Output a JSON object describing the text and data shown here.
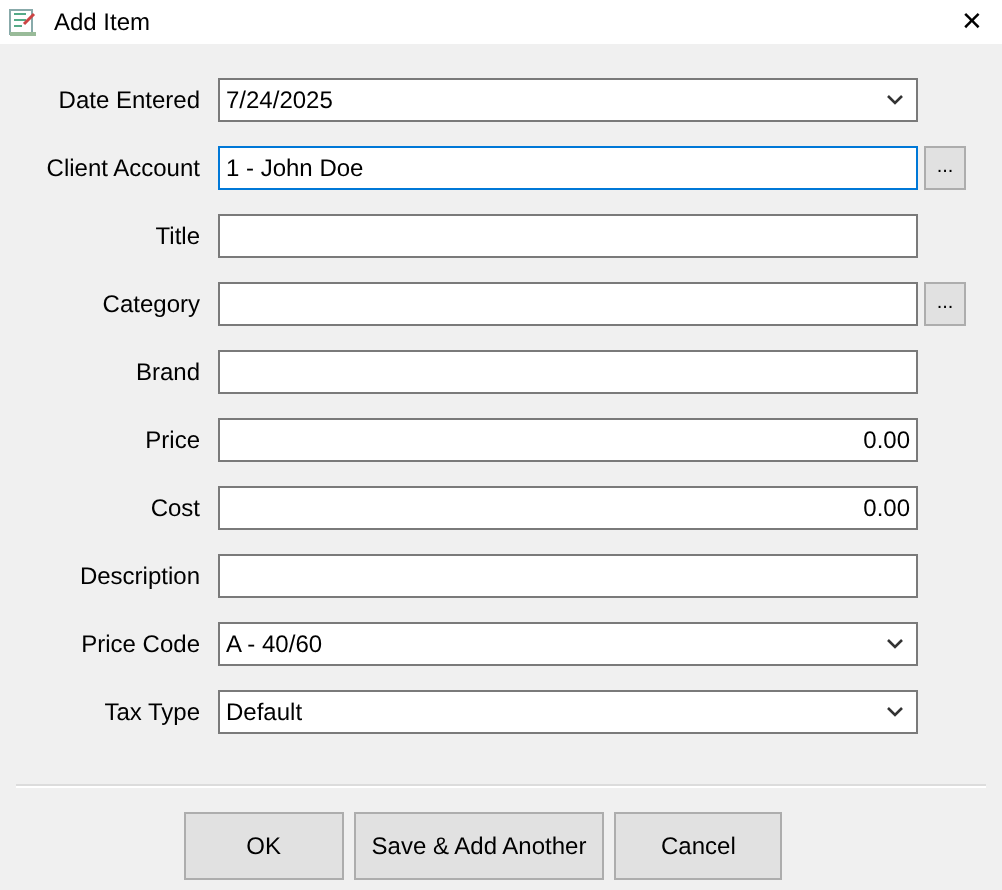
{
  "window": {
    "title": "Add Item",
    "close": "✕"
  },
  "fields": [
    {
      "label": "Date Entered",
      "kind": "combo",
      "value": "7/24/2025",
      "focused": false
    },
    {
      "label": "Client Account",
      "kind": "browse",
      "value": "1 - John Doe",
      "focused": true,
      "button": "..."
    },
    {
      "label": "Title",
      "kind": "text",
      "focused": false
    },
    {
      "label": "Category",
      "kind": "browse",
      "focused": false,
      "button": "..."
    },
    {
      "label": "Brand",
      "kind": "text",
      "focused": false
    },
    {
      "label": "Price",
      "kind": "number",
      "value": "0.00",
      "focused": false
    },
    {
      "label": "Cost",
      "kind": "number",
      "value": "0.00",
      "focused": false
    },
    {
      "label": "Description",
      "kind": "text",
      "focused": false
    },
    {
      "label": "Price Code",
      "kind": "combo",
      "value": "A - 40/60",
      "focused": false
    },
    {
      "label": "Tax Type",
      "kind": "combo",
      "value": "Default",
      "focused": false
    }
  ],
  "buttons": [
    "OK",
    "Save & Add Another",
    "Cancel"
  ]
}
